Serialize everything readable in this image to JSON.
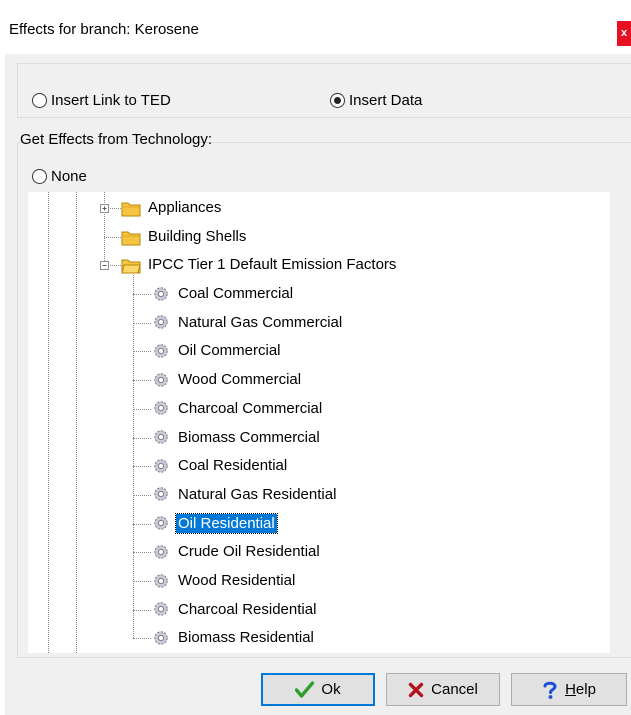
{
  "window": {
    "title": "Effects for branch: Kerosene",
    "close_label": "x"
  },
  "options": {
    "insert_link": "Insert Link to TED",
    "insert_data": "Insert Data",
    "selected": "insert_data"
  },
  "technology_group": {
    "label": "Get Effects from Technology:",
    "none_label": "None"
  },
  "tree": {
    "folders": [
      {
        "label": "Appliances",
        "expanded": false
      },
      {
        "label": "Building Shells",
        "expanded": null
      },
      {
        "label": "IPCC Tier 1 Default Emission Factors",
        "expanded": true
      }
    ],
    "items": [
      {
        "label": "Coal Commercial",
        "selected": false
      },
      {
        "label": "Natural Gas Commercial",
        "selected": false
      },
      {
        "label": "Oil Commercial",
        "selected": false
      },
      {
        "label": "Wood Commercial",
        "selected": false
      },
      {
        "label": "Charcoal Commercial",
        "selected": false
      },
      {
        "label": "Biomass Commercial",
        "selected": false
      },
      {
        "label": "Coal Residential",
        "selected": false
      },
      {
        "label": "Natural Gas Residential",
        "selected": false
      },
      {
        "label": "Oil Residential",
        "selected": true
      },
      {
        "label": "Crude Oil Residential",
        "selected": false
      },
      {
        "label": "Wood Residential",
        "selected": false
      },
      {
        "label": "Charcoal Residential",
        "selected": false
      },
      {
        "label": "Biomass Residential",
        "selected": false
      }
    ]
  },
  "buttons": {
    "ok": "Ok",
    "cancel": "Cancel",
    "help_prefix": "",
    "help_underlined": "H",
    "help_rest": "elp"
  },
  "colors": {
    "selection": "#0078d7",
    "close": "#e81123",
    "check": "#2e9e2e",
    "cross": "#b3121c",
    "help": "#1f4fd8",
    "folder": "#f5c542"
  }
}
